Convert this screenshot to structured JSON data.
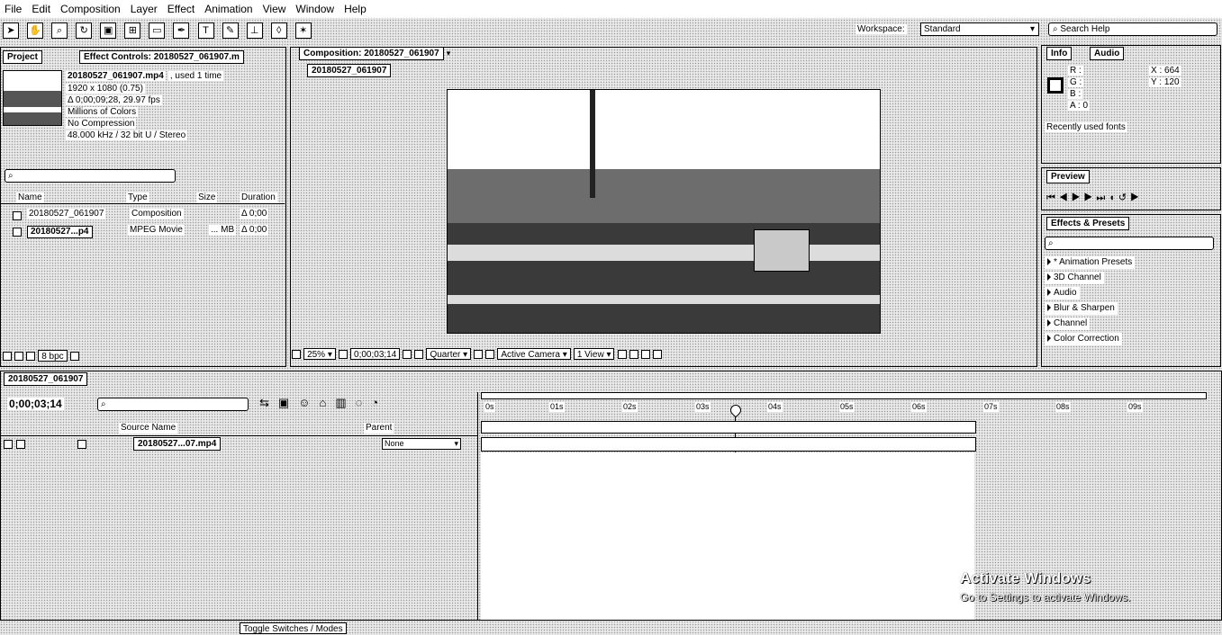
{
  "menu": [
    "File",
    "Edit",
    "Composition",
    "Layer",
    "Effect",
    "Animation",
    "View",
    "Window",
    "Help"
  ],
  "toolbar": {
    "workspace_label": "Workspace:",
    "workspace_value": "Standard",
    "search_help_placeholder": "Search Help"
  },
  "project_panel": {
    "tab_project": "Project",
    "tab_effect_controls": "Effect Controls: 20180527_061907.m",
    "footage_name": "20180527_061907.mp4",
    "used_text": ", used 1 time",
    "info_lines": [
      "1920 x 1080 (0.75)",
      "Δ 0;00;09;28, 29.97 fps",
      "Millions of Colors",
      "No Compression",
      "48.000 kHz / 32 bit U / Stereo"
    ],
    "columns": [
      "Name",
      "Type",
      "Size",
      "Duration"
    ],
    "items": [
      {
        "name": "20180527_061907",
        "type": "Composition",
        "size": "",
        "duration": "Δ 0;00"
      },
      {
        "name": "20180527...p4",
        "type": "MPEG Movie",
        "size": "... MB",
        "duration": "Δ 0;00"
      }
    ],
    "bpc": "8 bpc"
  },
  "composition_panel": {
    "tab": "Composition: 20180527_061907",
    "sub_tab": "20180527_061907",
    "zoom": "25%",
    "timecode": "0;00;03;14",
    "resolution": "Quarter",
    "camera": "Active Camera",
    "view": "1 View"
  },
  "info_panel": {
    "tab_info": "Info",
    "tab_audio": "Audio",
    "channels": [
      "R :",
      "G :",
      "B :",
      "A : 0"
    ],
    "x_value": "X : 664",
    "y_value": "Y : 120",
    "hint": "Recently used fonts"
  },
  "preview_panel": {
    "tab": "Preview"
  },
  "effects_panel": {
    "tab": "Effects & Presets",
    "items": [
      "* Animation Presets",
      "3D Channel",
      "Audio",
      "Blur & Sharpen",
      "Channel",
      "Color Correction"
    ]
  },
  "timeline": {
    "tab": "20180527_061907",
    "timecode": "0;00;03;14",
    "columns": [
      "Source Name",
      "Parent"
    ],
    "layer_name": "20180527...07.mp4",
    "parent_value": "None",
    "ruler": [
      "0s",
      "01s",
      "02s",
      "03s",
      "04s",
      "05s",
      "06s",
      "07s",
      "08s",
      "09s"
    ],
    "footer_toggle": "Toggle Switches / Modes"
  },
  "watermark": {
    "title": "Activate Windows",
    "subtitle": "Go to Settings to activate Windows."
  }
}
